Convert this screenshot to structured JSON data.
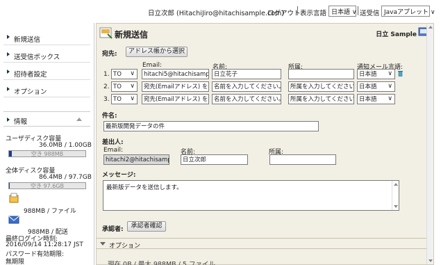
{
  "header": {
    "user": "日立次郎 (HitachiJiro@hitachisample.com)",
    "logout": "ログアウト",
    "lang_label": "表示言語",
    "lang_value": "日本語",
    "send_label": "送受信",
    "send_value": "Javaアプレット"
  },
  "sidebar": {
    "items": [
      "新規送信",
      "送受信ボックス",
      "招待者設定",
      "オプション"
    ],
    "info_title": "情報",
    "user_disk_label": "ユーザディスク容量",
    "user_disk_value": "36.0MB / 1.00GB",
    "user_disk_free": "空き 988MB",
    "user_disk_used_fraction": 0.035,
    "all_disk_label": "全体ディスク容量",
    "all_disk_value": "86.4MB / 97.7GB",
    "all_disk_free": "空き 97.6GB",
    "all_disk_used_fraction": 0.01,
    "per_file": "988MB / ファイル",
    "per_send": "988MB / 配送",
    "last_login_label": "最終ログイン時刻:",
    "last_login_value": "2016/09/14 11:28:17 JST",
    "password_label": "パスワード有効期限:",
    "password_value": "無期限"
  },
  "main": {
    "title": "新規送信",
    "brand": "日立 Sample",
    "to_label": "宛先:",
    "address_book_button": "アドレス帳から選択",
    "col_email": "Email:",
    "col_name": "名前:",
    "col_org": "所属:",
    "col_lang": "通知メール言語:",
    "rows": [
      {
        "num": "1.",
        "type": "TO",
        "email": "hitachi5@hitachisample.",
        "name": "日立花子",
        "org": "",
        "lang": "日本語"
      },
      {
        "num": "2.",
        "type": "TO",
        "email": "宛先(Emailアドレス) を",
        "name": "名前を入力してください。",
        "org": "所属を入力してください。",
        "lang": "日本語"
      },
      {
        "num": "3.",
        "type": "TO",
        "email": "宛先(Emailアドレス) を",
        "name": "名前を入力してください。",
        "org": "所属を入力してください。",
        "lang": "日本語"
      }
    ],
    "subject_label": "件名:",
    "subject_value": "最新版開発データの件",
    "sender_label": "差出人:",
    "sender_email_label": "Email:",
    "sender_email": "hitachi2@hitachisamp",
    "sender_name_label": "名前:",
    "sender_name": "日立次郎",
    "sender_org_label": "所属:",
    "sender_org": "",
    "message_label": "メッセージ:",
    "message_value": "最新版データを送信します。",
    "approver_label": "承認者:",
    "approver_button": "承認者確認",
    "options_label": "オプション",
    "footer_text": "現在 0B / 最大 988MB / 5 ファイル"
  }
}
